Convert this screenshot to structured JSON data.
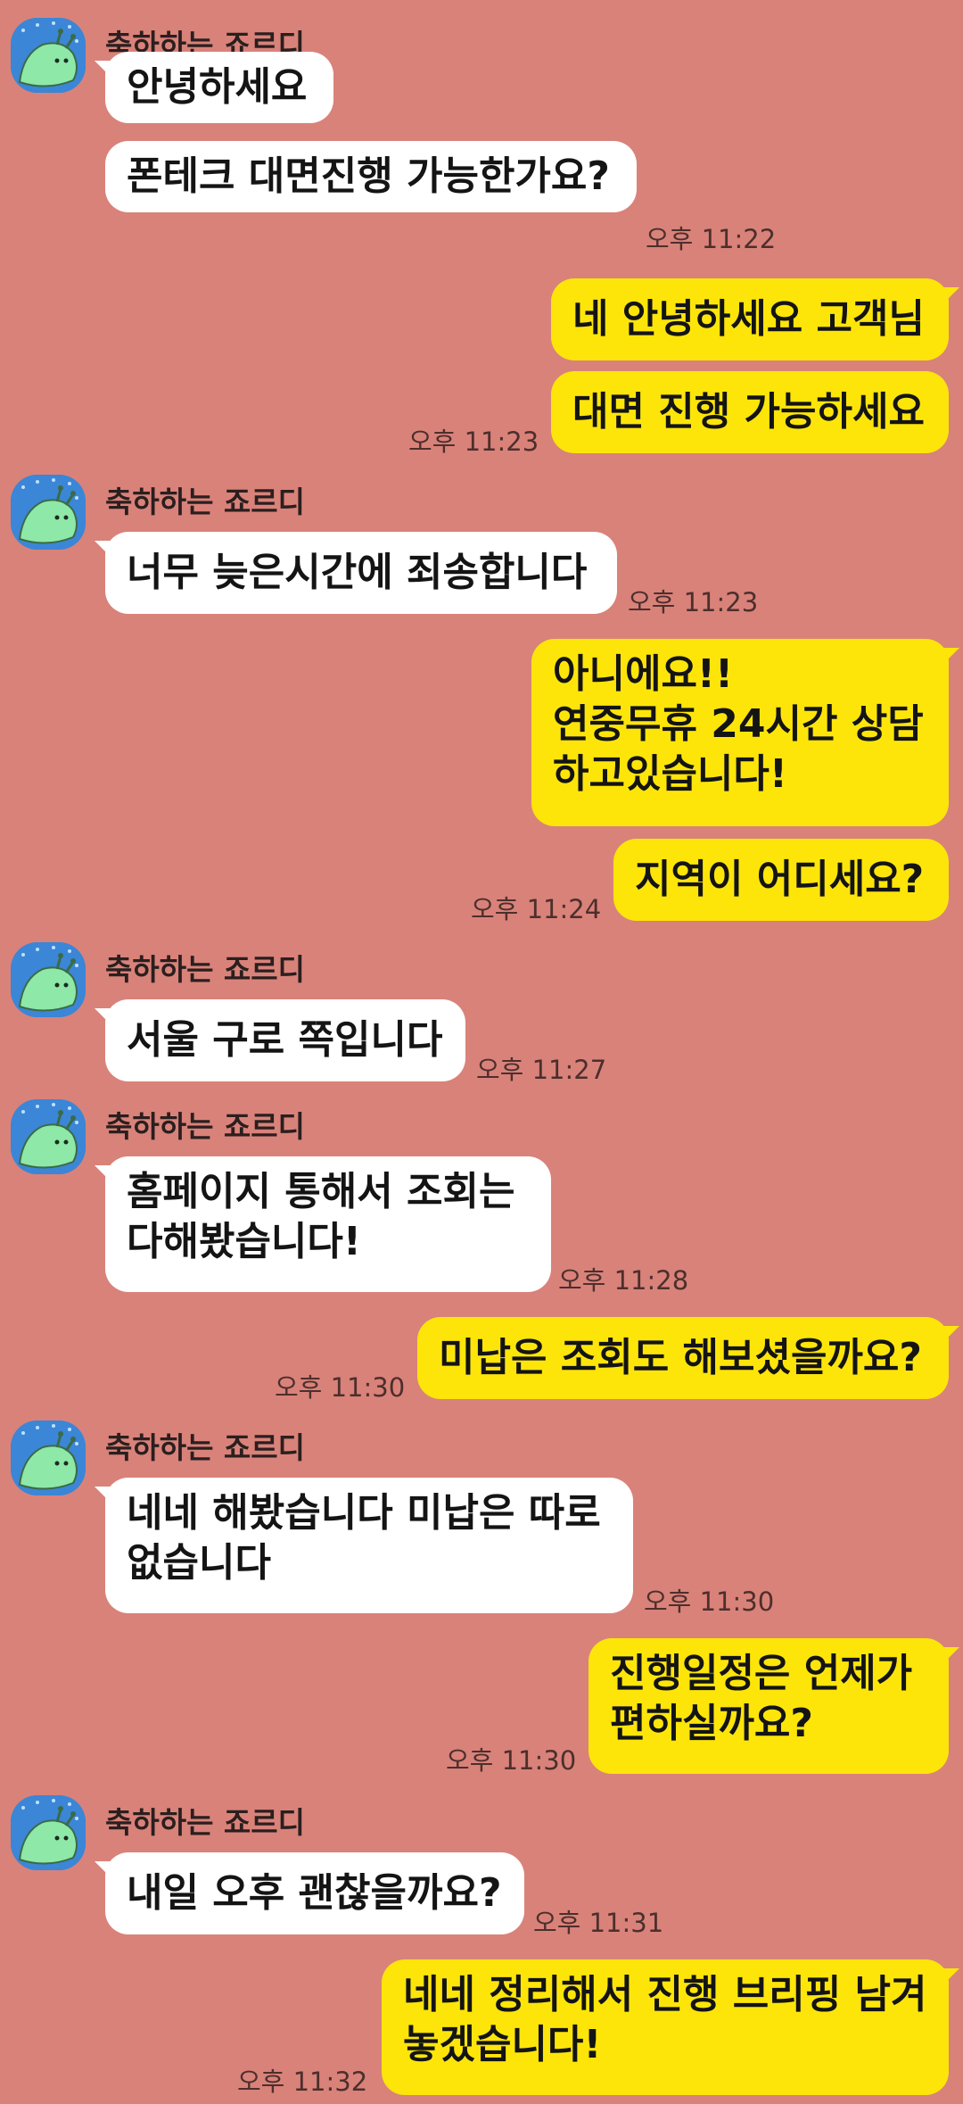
{
  "sender_name": "축하하는 죠르디",
  "messages": [
    {
      "text": "안녕하세요"
    },
    {
      "text": "폰테크 대면진행 가능한가요?",
      "time": "오후 11:22"
    },
    {
      "text": "네 안녕하세요 고객님"
    },
    {
      "text": "대면 진행 가능하세요",
      "time": "오후 11:23"
    },
    {
      "text": "너무 늦은시간에 죄송합니다",
      "time": "오후 11:23"
    },
    {
      "lines": [
        "아니에요!!",
        "연중무휴 24시간 상담",
        "하고있습니다!"
      ]
    },
    {
      "text": "지역이 어디세요?",
      "time": "오후 11:24"
    },
    {
      "text": "서울 구로 쪽입니다",
      "time": "오후 11:27"
    },
    {
      "lines": [
        "홈페이지 통해서 조회는",
        "다해봤습니다!"
      ],
      "time": "오후 11:28"
    },
    {
      "text": "미납은 조회도 해보셨을까요?",
      "time": "오후 11:30"
    },
    {
      "lines": [
        "네네 해봤습니다 미납은 따로",
        "없습니다"
      ],
      "time": "오후 11:30"
    },
    {
      "lines": [
        "진행일정은 언제가",
        "편하실까요?"
      ],
      "time": "오후 11:30"
    },
    {
      "text": "내일 오후 괜찮을까요?",
      "time": "오후 11:31"
    },
    {
      "lines": [
        "네네 정리해서 진행 브리핑 남겨",
        "놓겠습니다!"
      ],
      "time": "오후 11:32"
    }
  ]
}
